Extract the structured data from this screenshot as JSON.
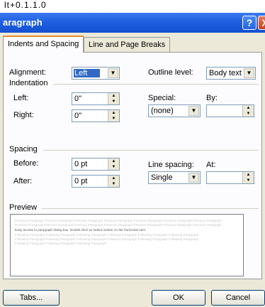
{
  "top_cutoff_text": "lt+0.1.1.0",
  "title": "aragraph",
  "help_glyph": "?",
  "close_glyph": "X",
  "tabs": [
    {
      "label": "Indents and Spacing"
    },
    {
      "label": "Line and Page Breaks"
    }
  ],
  "general": {
    "alignment_label": "Alignment:",
    "alignment_value": "Left",
    "outline_label": "Outline level:",
    "outline_value": "Body text"
  },
  "indentation": {
    "section_label": "Indentation",
    "left_label": "Left:",
    "left_value": "0\"",
    "right_label": "Right:",
    "right_value": "0\"",
    "special_label": "Special:",
    "special_value": "(none)",
    "by_label": "By:",
    "by_value": ""
  },
  "spacing": {
    "section_label": "Spacing",
    "before_label": "Before:",
    "before_value": "0 pt",
    "after_label": "After:",
    "after_value": "0 pt",
    "line_spacing_label": "Line spacing:",
    "line_spacing_value": "Single",
    "at_label": "At:",
    "at_value": ""
  },
  "preview": {
    "section_label": "Preview",
    "lines": [
      "Previous Paragraph Previous Paragraph Previous Paragraph Previous Paragraph Previous Paragraph Previous Paragraph Previous Paragraph",
      "Previous Paragraph Previous Paragraph Previous Paragraph Previous Paragraph Previous Paragraph Previous Paragraph Previous Paragraph",
      "Easy access to paragraph dialog box. Double-click an indent marker on the horizontal ruler.",
      "Following Paragraph Following Paragraph Following Paragraph Following Paragraph Following Paragraph Following Paragraph",
      "Following Paragraph Following Paragraph Following Paragraph Following Paragraph Following Paragraph Following Paragraph",
      "Following Paragraph Following Paragraph Following Paragraph"
    ]
  },
  "buttons": {
    "tabs": "Tabs...",
    "ok": "OK",
    "cancel": "Cancel"
  },
  "colors": {
    "titlebar": "#1f5fe0",
    "dialog_bg": "#ece9d8",
    "selection": "#316ac5"
  }
}
